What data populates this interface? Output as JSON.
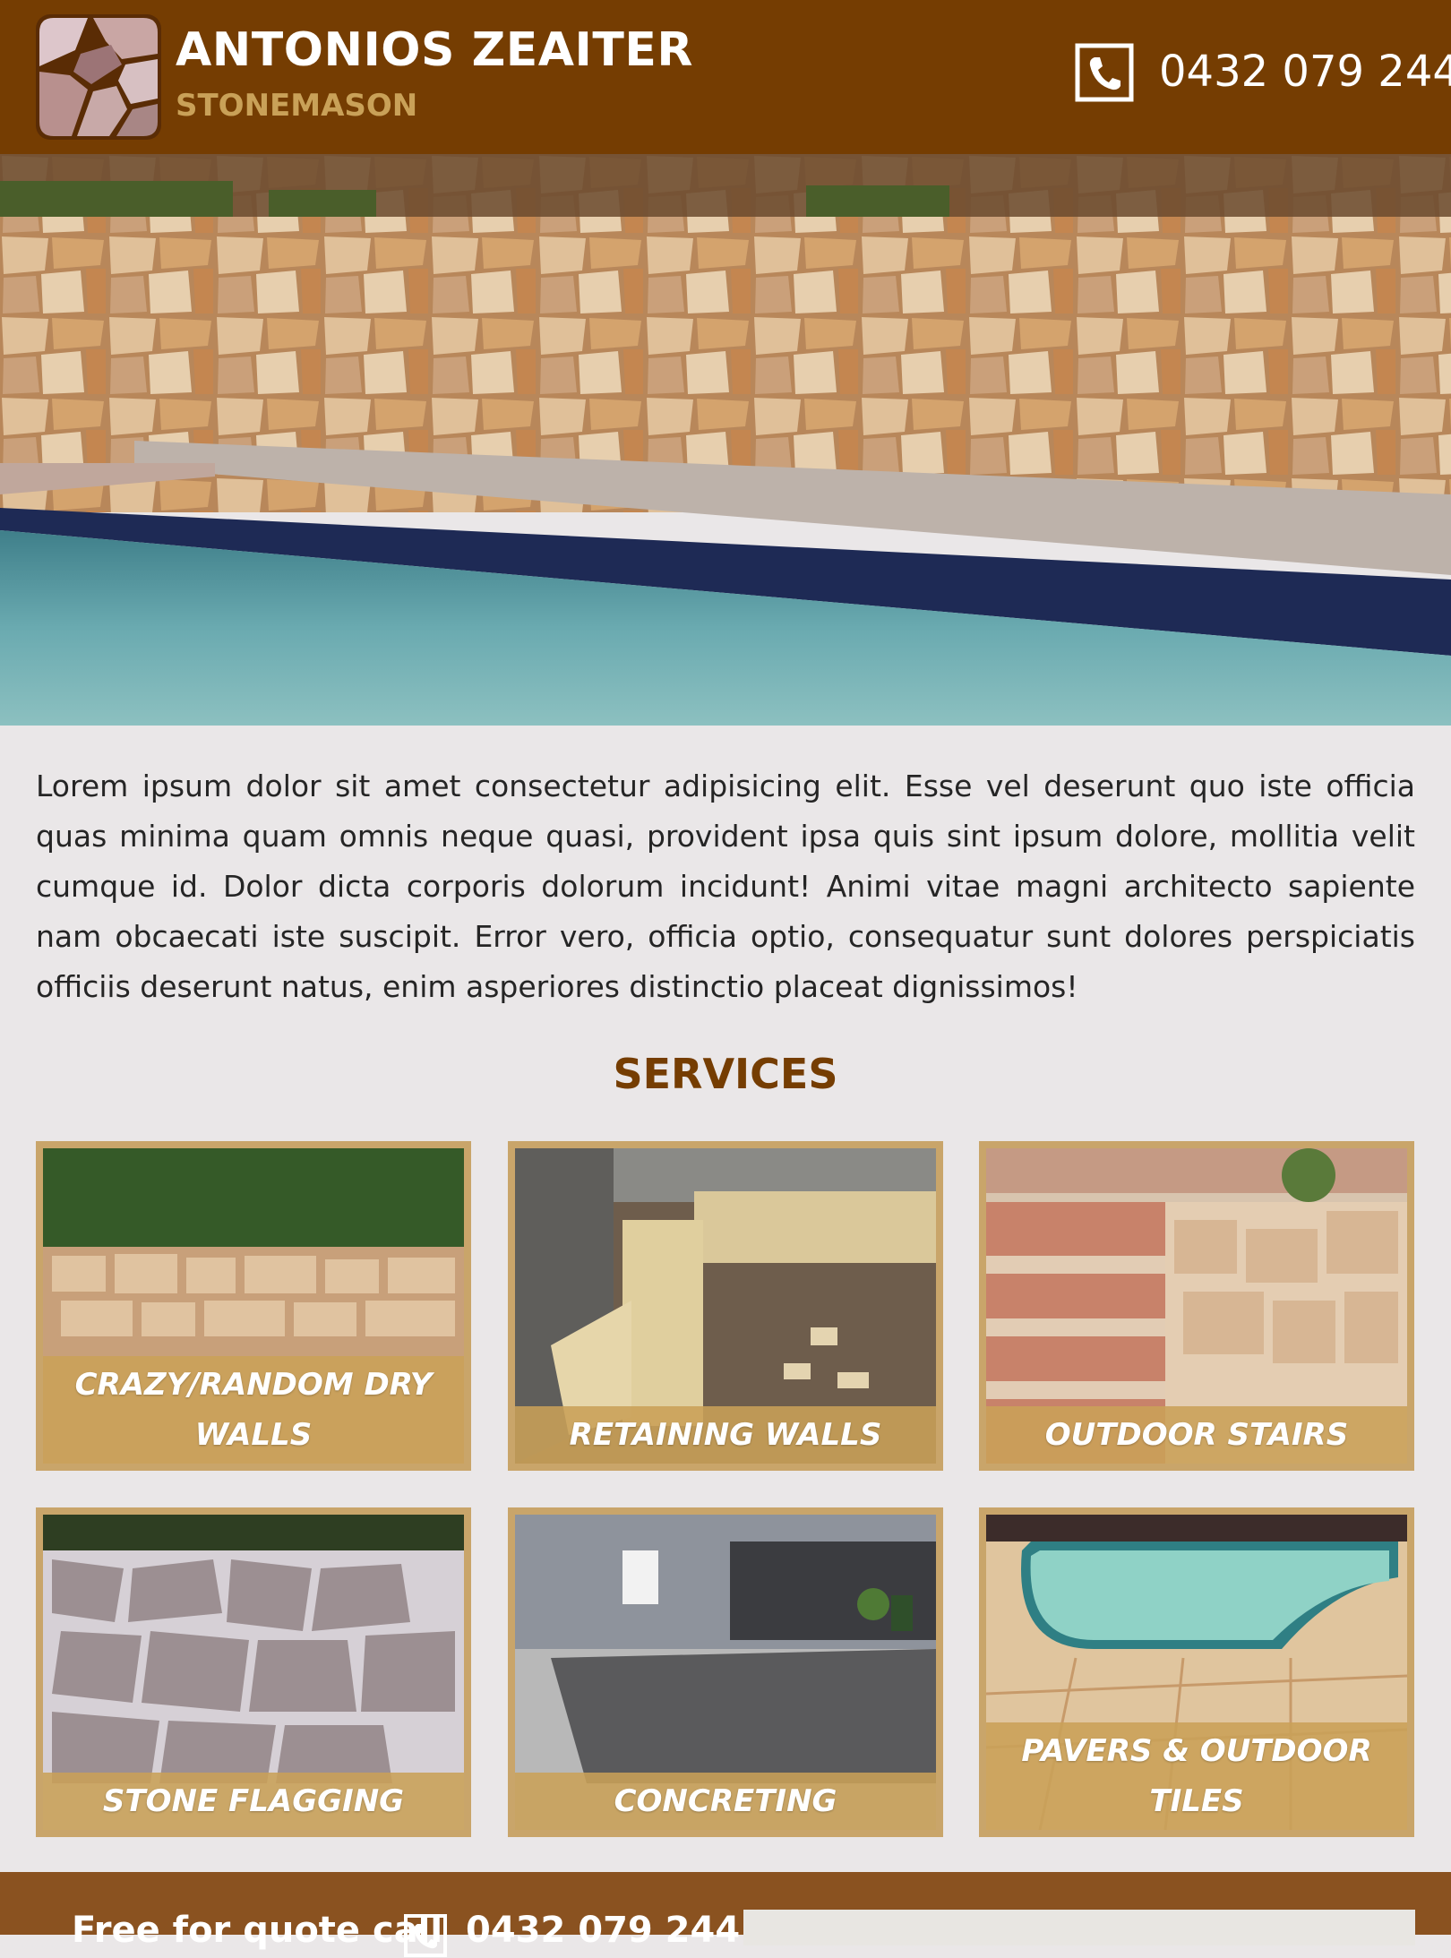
{
  "header": {
    "brand_name": "ANTONIOS ZEAITER",
    "brand_subtitle": "STONEMASON",
    "phone": "0432 079 244"
  },
  "intro": {
    "text": "Lorem ipsum dolor sit amet consectetur adipisicing elit. Esse vel deserunt quo iste officia quas minima quam omnis neque quasi, provident ipsa quis sint ipsum dolore, mollitia velit cumque id. Dolor dicta corporis dolorum incidunt! Animi vitae magni architecto sapiente nam obcaecati iste suscipit. Error vero, officia optio, consequatur sunt dolores perspiciatis officiis deserunt natus, enim asperiores distinctio placeat dignissimos!"
  },
  "services": {
    "title": "SERVICES",
    "items": [
      {
        "label": "CRAZY/RANDOM DRY WALLS"
      },
      {
        "label": "RETAINING WALLS"
      },
      {
        "label": "OUTDOOR STAIRS"
      },
      {
        "label": "STONE FLAGGING"
      },
      {
        "label": "CONCRETING"
      },
      {
        "label": "PAVERS & OUTDOOR TILES"
      }
    ]
  },
  "footer": {
    "text": "Free for quote call",
    "phone": "0432 079 244"
  },
  "colors": {
    "header_bg": "#753d02",
    "accent_gold": "#c9a158",
    "page_bg": "#eae7e8",
    "footer_bg": "#8a5220"
  },
  "icons": {
    "logo": "stone-logo-icon",
    "phone": "phone-icon"
  }
}
